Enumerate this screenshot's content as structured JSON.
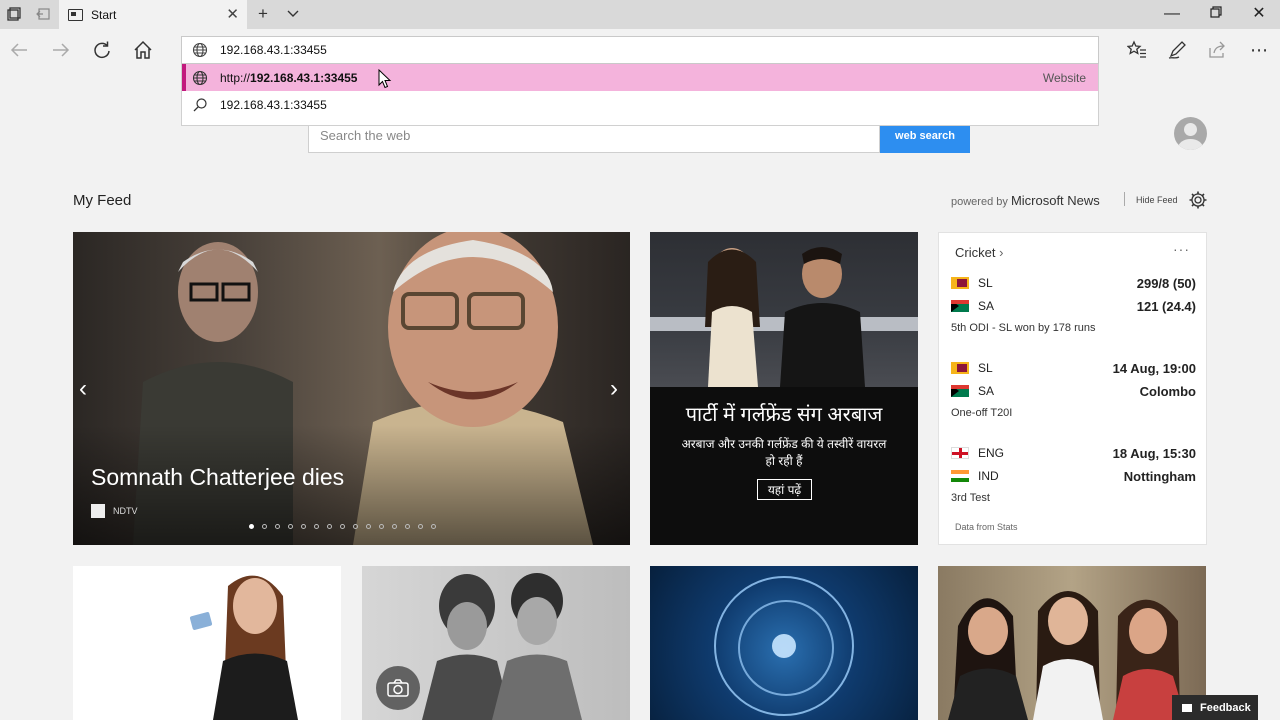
{
  "browser": {
    "tab_title": "Start",
    "address_value": "192.168.43.1:33455"
  },
  "suggestions": [
    {
      "prefix": "http://",
      "bold": "192.168.43.1:33455",
      "type": "Website"
    },
    {
      "prefix": "",
      "bold": "",
      "text": "192.168.43.1:33455"
    }
  ],
  "search": {
    "placeholder": "Search the web",
    "button": "web search"
  },
  "feed": {
    "title": "My Feed",
    "powered_by": "powered by",
    "brand": "Microsoft News",
    "hide": "Hide Feed"
  },
  "hero": {
    "title": "Somnath Chatterjee dies",
    "source": "NDTV",
    "dots_total": 15,
    "dots_active": 0
  },
  "card2": {
    "headline": "पार्टी में गर्लफ्रेंड संग अरबाज",
    "body": "अरबाज और उनकी गर्लफ्रेंड की ये तस्वीरें वायरल हो रही हैं",
    "button": "यहां पढ़ें"
  },
  "cricket": {
    "title": "Cricket",
    "more": "···",
    "matches": [
      {
        "t1": "SL",
        "t1_score": "299/8 (50)",
        "t2": "SA",
        "t2_score": "121 (24.4)",
        "note": "5th ODI - SL won by 178 runs"
      },
      {
        "t1": "SL",
        "t1_score": "14 Aug, 19:00",
        "t2": "SA",
        "t2_score": "Colombo",
        "note": "One-off T20I"
      },
      {
        "t1": "ENG",
        "t1_score": "18 Aug, 15:30",
        "t2": "IND",
        "t2_score": "Nottingham",
        "note": "3rd Test"
      }
    ],
    "footer": "Data from Stats"
  },
  "feedback": "Feedback"
}
